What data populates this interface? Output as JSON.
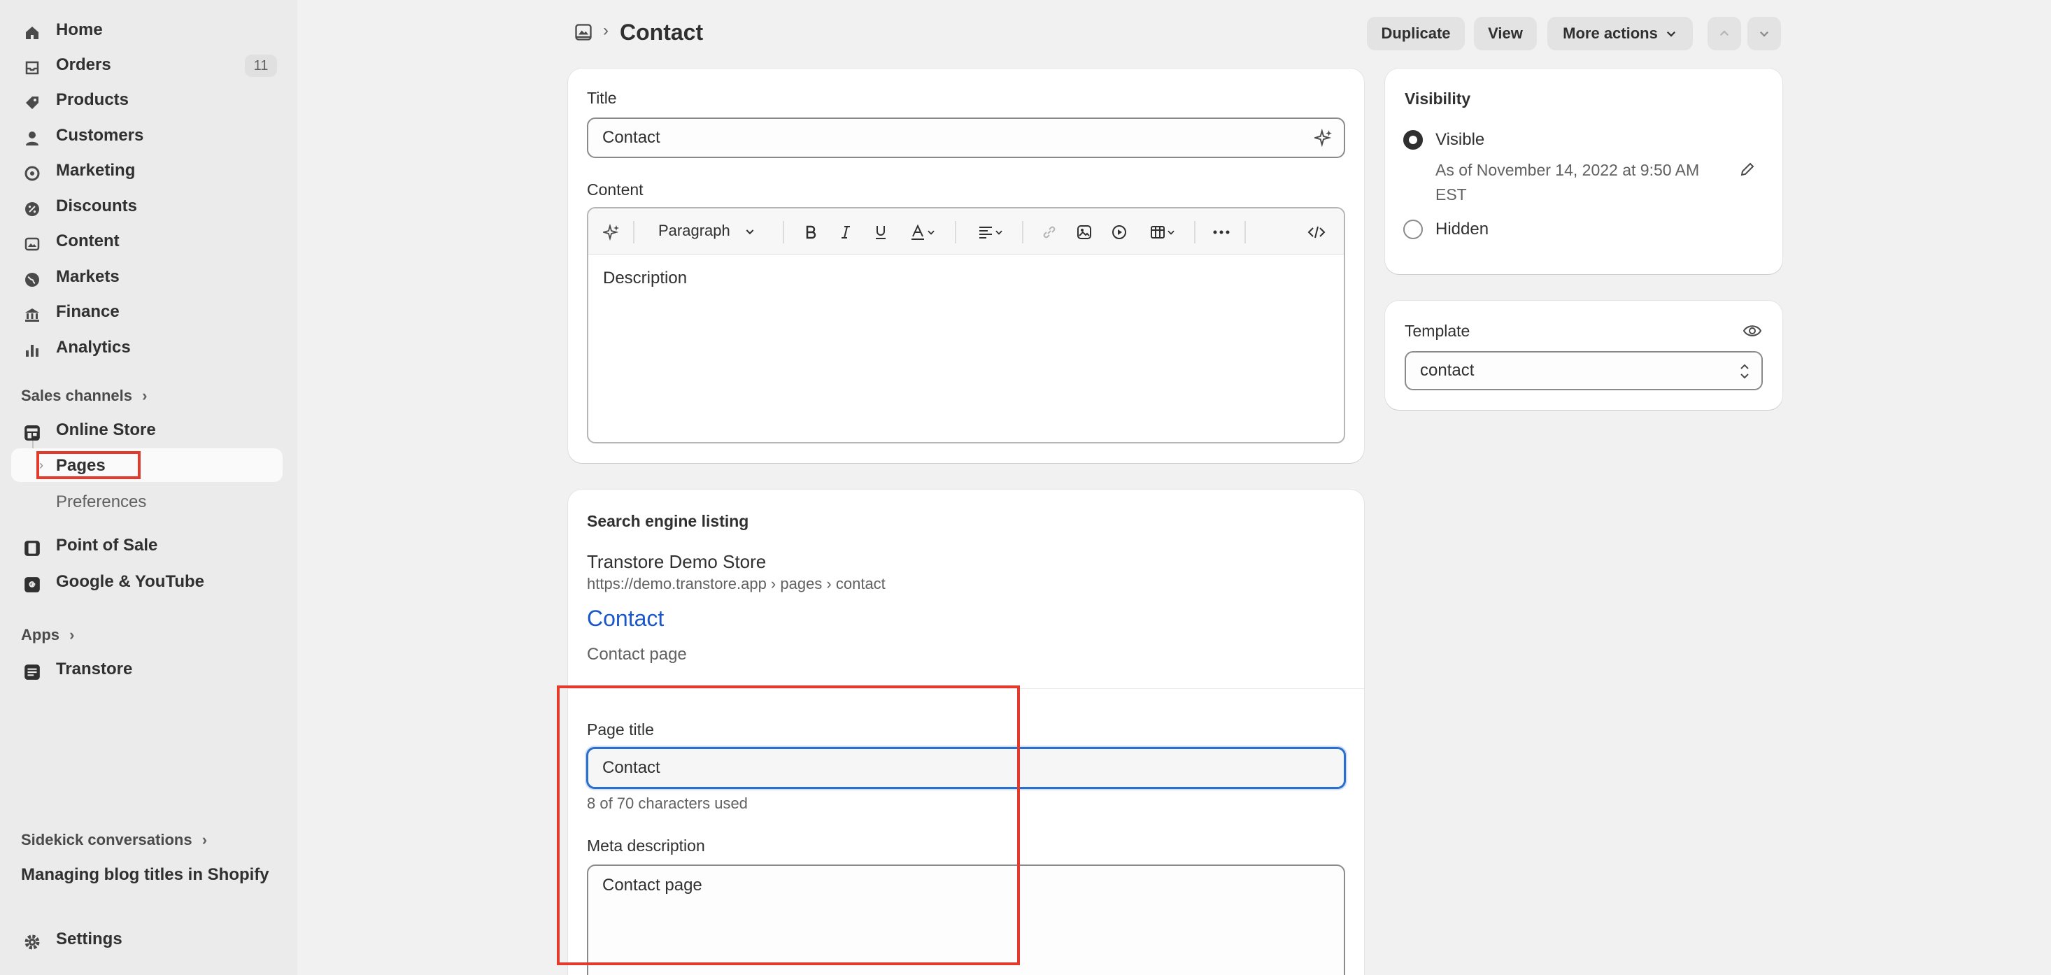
{
  "sidebar": {
    "items": [
      {
        "label": "Home",
        "icon": "home-icon"
      },
      {
        "label": "Orders",
        "icon": "orders-icon",
        "badge": "11"
      },
      {
        "label": "Products",
        "icon": "tag-icon"
      },
      {
        "label": "Customers",
        "icon": "person-icon"
      },
      {
        "label": "Marketing",
        "icon": "target-icon"
      },
      {
        "label": "Discounts",
        "icon": "discount-icon"
      },
      {
        "label": "Content",
        "icon": "content-icon"
      },
      {
        "label": "Markets",
        "icon": "globe-icon"
      },
      {
        "label": "Finance",
        "icon": "bank-icon"
      },
      {
        "label": "Analytics",
        "icon": "bar-chart-icon"
      }
    ],
    "sales_channels_label": "Sales channels",
    "online_store_label": "Online Store",
    "pages_label": "Pages",
    "preferences_label": "Preferences",
    "point_of_sale_label": "Point of Sale",
    "google_youtube_label": "Google & YouTube",
    "apps_label": "Apps",
    "transtore_label": "Transtore",
    "sidekick_label": "Sidekick conversations",
    "sidekick_item": "Managing blog titles in Shopify",
    "settings_label": "Settings"
  },
  "header": {
    "crumb_sep": "›",
    "title": "Contact",
    "duplicate_label": "Duplicate",
    "view_label": "View",
    "more_actions_label": "More actions"
  },
  "main_card": {
    "title_label": "Title",
    "title_value": "Contact",
    "content_label": "Content",
    "paragraph_label": "Paragraph",
    "editor_text": "Description"
  },
  "seo": {
    "heading": "Search engine listing",
    "store_name": "Transtore Demo Store",
    "url": "https://demo.transtore.app › pages › contact",
    "preview_title": "Contact",
    "preview_desc": "Contact page",
    "page_title_label": "Page title",
    "page_title_value": "Contact",
    "char_count": "8 of 70 characters used",
    "meta_label": "Meta description",
    "meta_value": "Contact page"
  },
  "visibility": {
    "heading": "Visibility",
    "visible_label": "Visible",
    "date_line1": "As of November 14, 2022 at 9:50 AM",
    "date_line2": "EST",
    "hidden_label": "Hidden"
  },
  "template": {
    "heading": "Template",
    "value": "contact"
  },
  "colors": {
    "accent": "#2c6ecb",
    "link": "#1a56c9",
    "highlight": "#e23b2c"
  }
}
